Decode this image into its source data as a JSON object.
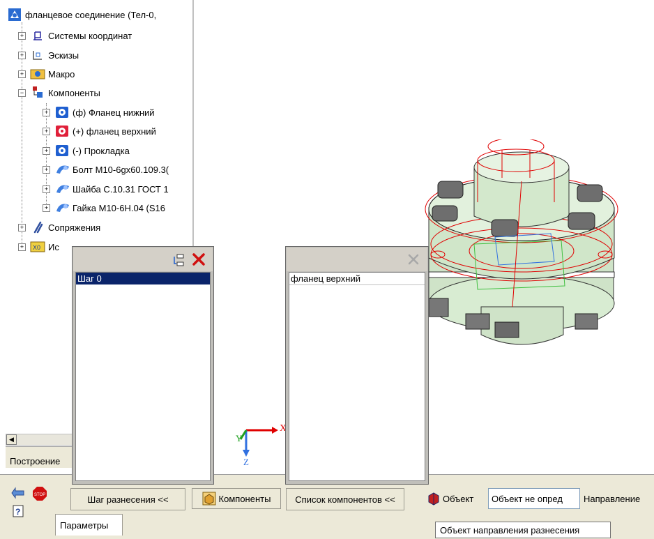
{
  "tree": {
    "root": "фланцевое соединение (Тел-0,",
    "items": [
      {
        "label": "Системы координат",
        "expander": "+",
        "icon": "coordinate-system-icon"
      },
      {
        "label": "Эскизы",
        "expander": "+",
        "icon": "sketch-icon"
      },
      {
        "label": "Макро",
        "expander": "+",
        "icon": "macro-icon"
      },
      {
        "label": "Компоненты",
        "expander": "−",
        "icon": "components-icon"
      },
      {
        "label": "(ф) Фланец нижний",
        "expander": "+",
        "icon": "part-blue-icon"
      },
      {
        "label": "(+) фланец верхний",
        "expander": "+",
        "icon": "part-red-icon"
      },
      {
        "label": "(-) Прокладка",
        "expander": "+",
        "icon": "part-blue-icon"
      },
      {
        "label": "Болт М10-6gx60.109.3(",
        "expander": "+",
        "icon": "standard-part-icon"
      },
      {
        "label": "Шайба С.10.31 ГОСТ 1",
        "expander": "+",
        "icon": "standard-part-icon"
      },
      {
        "label": "Гайка  М10-6Н.04 (S16",
        "expander": "+",
        "icon": "standard-part-icon"
      },
      {
        "label": "Сопряжения",
        "expander": "+",
        "icon": "mates-icon"
      },
      {
        "label": "Ис",
        "expander": "+",
        "icon": "variables-icon"
      }
    ]
  },
  "build_tab": "Построение",
  "steps_panel": {
    "items": [
      "Шаг 0"
    ],
    "selected": 0
  },
  "components_panel": {
    "items": [
      "фланец верхний"
    ]
  },
  "axis": {
    "x": "X",
    "y": "Y",
    "z": "Z"
  },
  "toolbar": {
    "steps_button": "Шаг разнесения  <<",
    "components_button": "Компоненты",
    "list_button": "Список компонентов  <<",
    "object_button": "Объект",
    "object_value": "Объект не опред",
    "direction_label": "Направление",
    "params_tab": "Параметры",
    "tooltip": "Объект направления разнесения"
  },
  "colors": {
    "selection": "#0a246a",
    "model_fill": "#d8ecd2",
    "edge_red": "#e00000"
  }
}
